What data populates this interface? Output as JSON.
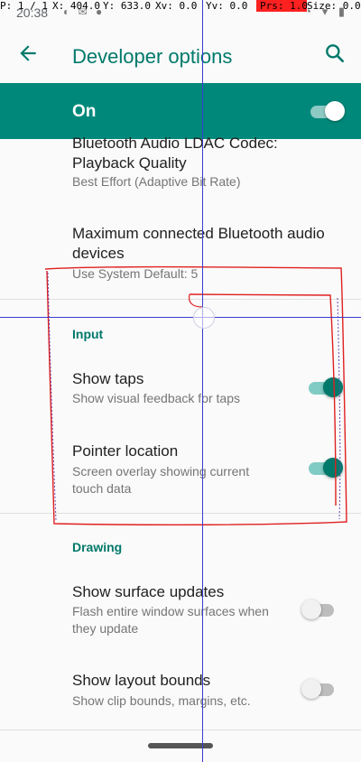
{
  "status_bar": {
    "time": "20:38"
  },
  "debug_overlay": {
    "pointer": "P: 1 / 1",
    "x": "X: 404.0",
    "y": "Y: 633.0",
    "xv": "Xv: 0.0",
    "yv": "Yv: 0.0",
    "prs": "Prs: 1.0",
    "size": "Size: 0.0"
  },
  "app_bar": {
    "title": "Developer options"
  },
  "master_switch": {
    "label": "On",
    "state": true
  },
  "items": {
    "ldac": {
      "title": "Bluetooth Audio LDAC Codec: Playback Quality",
      "subtitle": "Best Effort (Adaptive Bit Rate)"
    },
    "max_bt": {
      "title": "Maximum connected Bluetooth audio devices",
      "subtitle": "Use System Default: 5"
    },
    "show_taps": {
      "title": "Show taps",
      "subtitle": "Show visual feedback for taps",
      "state": true
    },
    "pointer_location": {
      "title": "Pointer location",
      "subtitle": "Screen overlay showing current touch data",
      "state": true
    },
    "surface_updates": {
      "title": "Show surface updates",
      "subtitle": "Flash entire window surfaces when they update",
      "state": false
    },
    "layout_bounds": {
      "title": "Show layout bounds",
      "subtitle": "Show clip bounds, margins, etc.",
      "state": false
    }
  },
  "categories": {
    "input": "Input",
    "drawing": "Drawing"
  },
  "colors": {
    "accent": "#00796b",
    "header_bg": "#00897b",
    "overlay_line": "#3b3bd1",
    "scribble": "#e02020"
  }
}
